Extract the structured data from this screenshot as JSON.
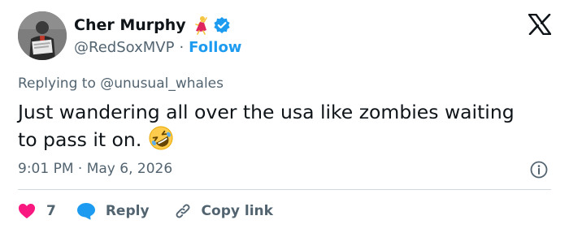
{
  "author": {
    "name": "Cher Murphy",
    "handle": "@RedSoxMVP",
    "separator": "·",
    "follow_label": "Follow"
  },
  "reply_context": {
    "prefix": "Replying to",
    "mention": "@unusual_whales"
  },
  "tweet": {
    "text": "Just wandering all over the usa like zombies waiting to pass it on."
  },
  "timestamp": {
    "time": "9:01 PM",
    "separator": "·",
    "date": "May 6, 2026"
  },
  "actions": {
    "like_count": "7",
    "reply_label": "Reply",
    "copy_link_label": "Copy link"
  },
  "colors": {
    "link_blue": "#1d9bf0",
    "heart_red": "#f91880",
    "text_secondary": "#536471",
    "divider": "#cfd9de"
  },
  "icons": {
    "logo": "x-logo-icon",
    "verified": "verified-badge-icon",
    "name_emoji": "dancer-emoji-icon",
    "tweet_emoji": "rolling-on-floor-laughing-emoji-icon",
    "info": "info-icon",
    "like": "heart-icon",
    "reply": "speech-bubble-icon",
    "copy": "link-icon"
  }
}
